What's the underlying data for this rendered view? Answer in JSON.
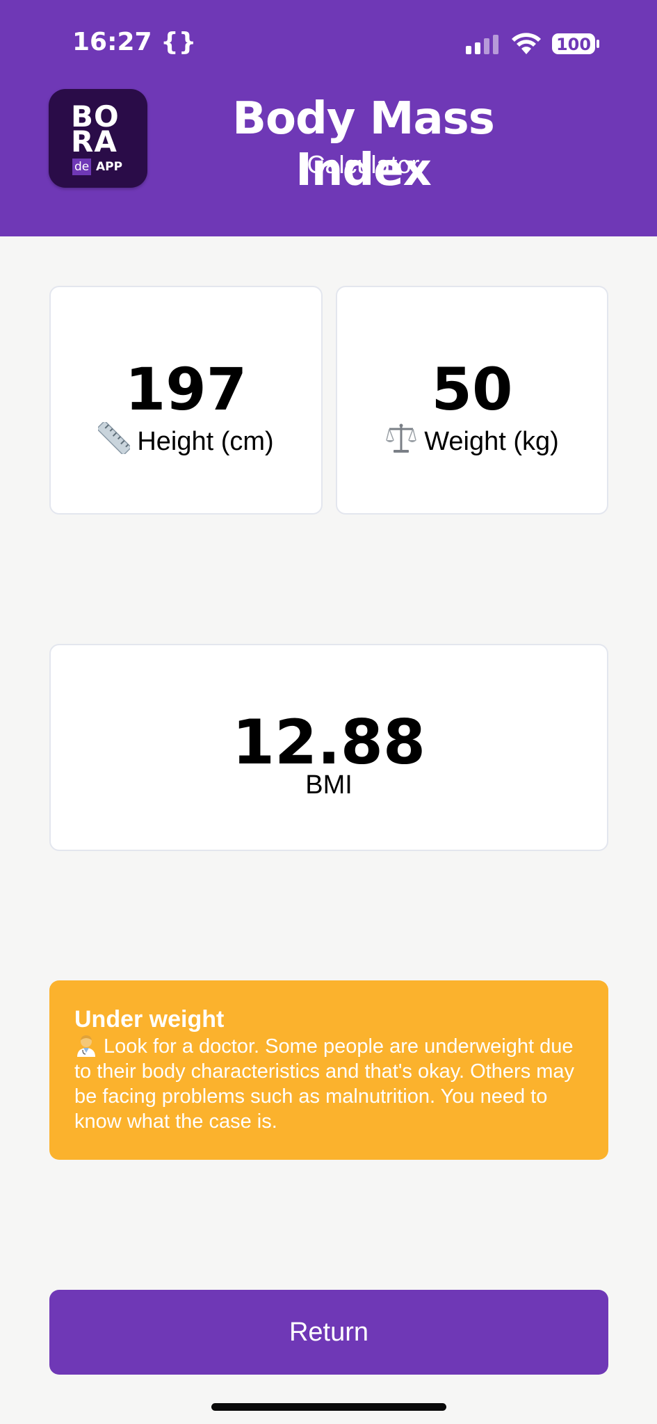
{
  "status_bar": {
    "time": "16:27 {}",
    "battery": "100"
  },
  "header": {
    "logo_line1": "BO",
    "logo_line2": "RA",
    "logo_de": "de",
    "logo_app": "APP",
    "title": "Body Mass Index",
    "subtitle": "Calculator"
  },
  "height_card": {
    "value": "197",
    "label": "Height (cm)",
    "icon": "ruler-icon"
  },
  "weight_card": {
    "value": "50",
    "label": "Weight (kg)",
    "icon": "scale-icon"
  },
  "bmi_card": {
    "value": "12.88",
    "label": "BMI"
  },
  "advice": {
    "title": "Under weight",
    "icon": "doctor-icon",
    "text": "Look for a doctor. Some people are underweight due to their body characteristics and that's okay. Others may be facing problems such as malnutrition. You need to know what the case is.",
    "background_color": "#fbb22d"
  },
  "actions": {
    "return_label": "Return"
  },
  "colors": {
    "brand": "#6f38b6",
    "background": "#f6f6f5"
  }
}
